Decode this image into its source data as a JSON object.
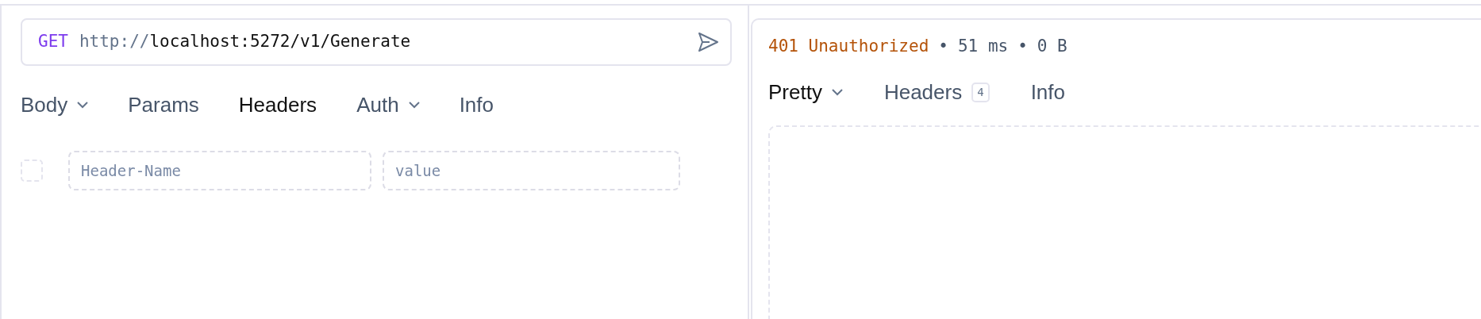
{
  "request": {
    "method": "GET",
    "url_scheme": "http://",
    "url_rest": "localhost:5272/v1/Generate",
    "tabs": [
      {
        "label": "Body",
        "selected": false,
        "dropdown": true
      },
      {
        "label": "Params",
        "selected": false,
        "dropdown": false
      },
      {
        "label": "Headers",
        "selected": true,
        "dropdown": false
      },
      {
        "label": "Auth",
        "selected": false,
        "dropdown": true
      },
      {
        "label": "Info",
        "selected": false,
        "dropdown": false
      }
    ],
    "headers": [
      {
        "checked": false,
        "name_placeholder": "Header-Name",
        "value_placeholder": "value"
      }
    ]
  },
  "response": {
    "status": "401 Unauthorized",
    "meta": [
      "•",
      "51 ms",
      "•",
      "0 B"
    ],
    "tabs": [
      {
        "label": "Pretty",
        "selected": true,
        "dropdown": true
      },
      {
        "label": "Headers",
        "selected": false,
        "dropdown": false,
        "count": "4"
      },
      {
        "label": "Info",
        "selected": false,
        "dropdown": false
      }
    ]
  }
}
